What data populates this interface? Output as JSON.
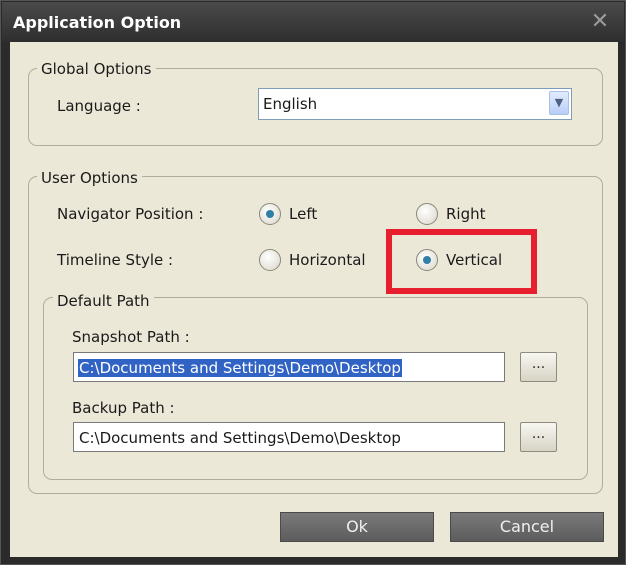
{
  "dialog": {
    "title": "Application Option",
    "close_glyph": "✕"
  },
  "global_options": {
    "legend": "Global Options",
    "language_label": "Language :",
    "language_value": "English",
    "dropdown_glyph": "▼"
  },
  "user_options": {
    "legend": "User Options",
    "navigator_label": "Navigator Position :",
    "navigator_options": [
      {
        "label": "Left",
        "checked": true
      },
      {
        "label": "Right",
        "checked": false
      }
    ],
    "timeline_label": "Timeline Style :",
    "timeline_options": [
      {
        "label": "Horizontal",
        "checked": false
      },
      {
        "label": "Vertical",
        "checked": true
      }
    ],
    "highlight_color": "#e61e2e"
  },
  "default_path": {
    "legend": "Default Path",
    "snapshot_label": "Snapshot Path :",
    "snapshot_value": "C:\\Documents and Settings\\Demo\\Desktop",
    "backup_label": "Backup Path :",
    "backup_value": "C:\\Documents and Settings\\Demo\\Desktop",
    "browse_label": "..."
  },
  "footer": {
    "ok_label": "Ok",
    "cancel_label": "Cancel"
  }
}
